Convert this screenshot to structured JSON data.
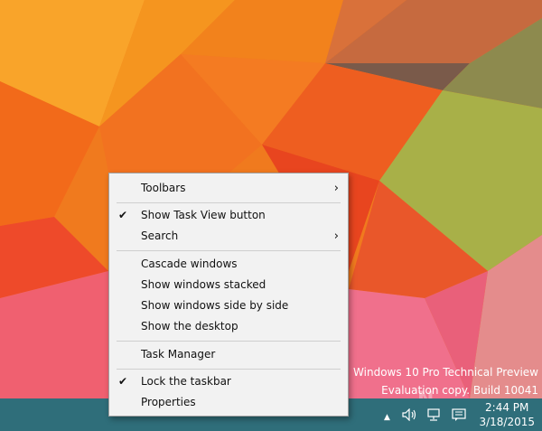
{
  "menu": {
    "items": [
      {
        "label": "Toolbars",
        "checked": false,
        "submenu": true
      },
      {
        "label": "Show Task View button",
        "checked": true,
        "submenu": false
      },
      {
        "label": "Search",
        "checked": false,
        "submenu": true
      },
      {
        "label": "Cascade windows",
        "checked": false,
        "submenu": false
      },
      {
        "label": "Show windows stacked",
        "checked": false,
        "submenu": false
      },
      {
        "label": "Show windows side by side",
        "checked": false,
        "submenu": false
      },
      {
        "label": "Show the desktop",
        "checked": false,
        "submenu": false
      },
      {
        "label": "Task Manager",
        "checked": false,
        "submenu": false
      },
      {
        "label": "Lock the taskbar",
        "checked": true,
        "submenu": false
      },
      {
        "label": "Properties",
        "checked": false,
        "submenu": false
      }
    ],
    "check_glyph": "✔",
    "arrow_glyph": "›"
  },
  "watermark": {
    "line1": "Windows 10 Pro Technical Preview",
    "line2": "Evaluation copy. Build 10041"
  },
  "taskbar": {
    "time": "2:44 PM",
    "date": "3/18/2015",
    "color": "#2f6e7a",
    "icons": [
      "chevron-up-icon",
      "volume-icon",
      "network-icon",
      "action-center-icon"
    ]
  }
}
